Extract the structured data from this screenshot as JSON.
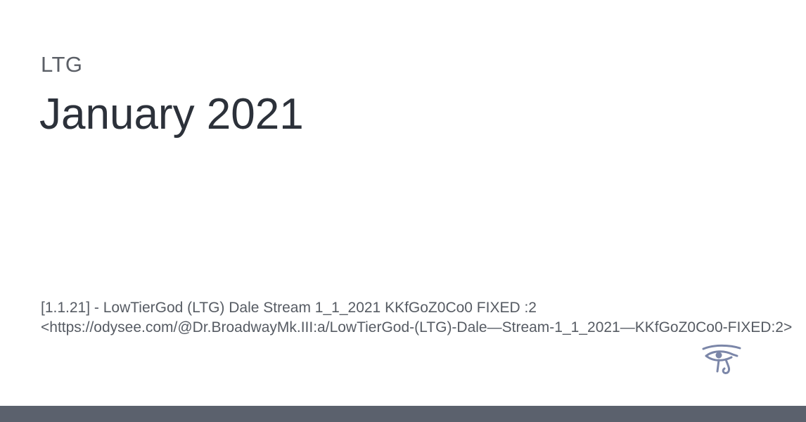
{
  "site": {
    "name": "LTG"
  },
  "page": {
    "title": "January 2021"
  },
  "excerpt": {
    "line1": "[1.1.21] - LowTierGod (LTG) Dale Stream 1_1_2021 KKfGoZ0Co0 FIXED :2",
    "line2": "<https://odysee.com/@Dr.BroadwayMk.III:a/LowTierGod-(LTG)-Dale—Stream-1_1_2021—KKfGoZ0Co0-FIXED:2>"
  },
  "logo": {
    "icon": "eye-of-horus-icon",
    "color": "#7b86a8"
  },
  "colors": {
    "background": "#ffffff",
    "title": "#2c313a",
    "site_name": "#5b5f66",
    "excerpt": "#565b63",
    "bottom_bar": "#5b616d"
  }
}
